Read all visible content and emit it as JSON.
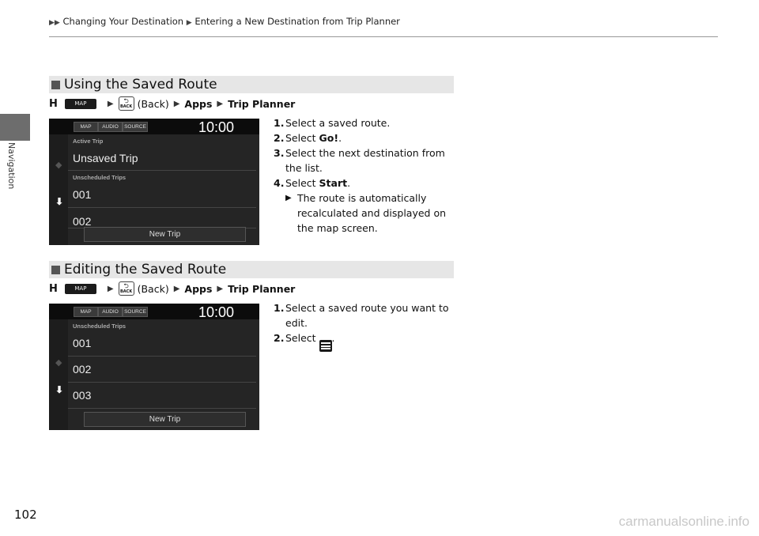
{
  "breadcrumb": {
    "items": [
      "Changing Your Destination",
      "Entering a New Destination from Trip Planner"
    ]
  },
  "side_tab": {
    "label": "Navigation"
  },
  "page_number": "102",
  "watermark": "carmanualsonline.info",
  "sections": [
    {
      "title": "Using the Saved Route",
      "path": {
        "home_icon": "H",
        "map_label": "MAP",
        "back_icon_text": "BACK",
        "back_label": "(Back)",
        "apps": "Apps",
        "trip_planner": "Trip Planner"
      },
      "screen": {
        "buttons": [
          "MAP",
          "AUDIO",
          "SOURCE"
        ],
        "clock": "10:00",
        "active_label": "Active Trip",
        "active_item": "Unsaved Trip",
        "unscheduled_label": "Unscheduled Trips",
        "items": [
          "001",
          "002"
        ],
        "new_trip": "New Trip"
      },
      "steps": [
        {
          "num": "1.",
          "pre": "Select a saved route.",
          "bold": "",
          "post": ""
        },
        {
          "num": "2.",
          "pre": "Select ",
          "bold": "Go!",
          "post": "."
        },
        {
          "num": "3.",
          "pre": "Select the next destination from the list.",
          "bold": "",
          "post": ""
        },
        {
          "num": "4.",
          "pre": "Select ",
          "bold": "Start",
          "post": "."
        }
      ],
      "result": "The route is automatically recalculated and displayed on the map screen."
    },
    {
      "title": "Editing the Saved Route",
      "path": {
        "home_icon": "H",
        "map_label": "MAP",
        "back_icon_text": "BACK",
        "back_label": "(Back)",
        "apps": "Apps",
        "trip_planner": "Trip Planner"
      },
      "screen": {
        "buttons": [
          "MAP",
          "AUDIO",
          "SOURCE"
        ],
        "clock": "10:00",
        "unscheduled_label": "Unscheduled Trips",
        "items": [
          "001",
          "002",
          "003"
        ],
        "new_trip": "New Trip"
      },
      "steps": [
        {
          "num": "1.",
          "pre": "Select a saved route you want to edit.",
          "bold": "",
          "post": ""
        },
        {
          "num": "2.",
          "pre": "Select ",
          "bold": "",
          "post": "."
        }
      ]
    }
  ]
}
